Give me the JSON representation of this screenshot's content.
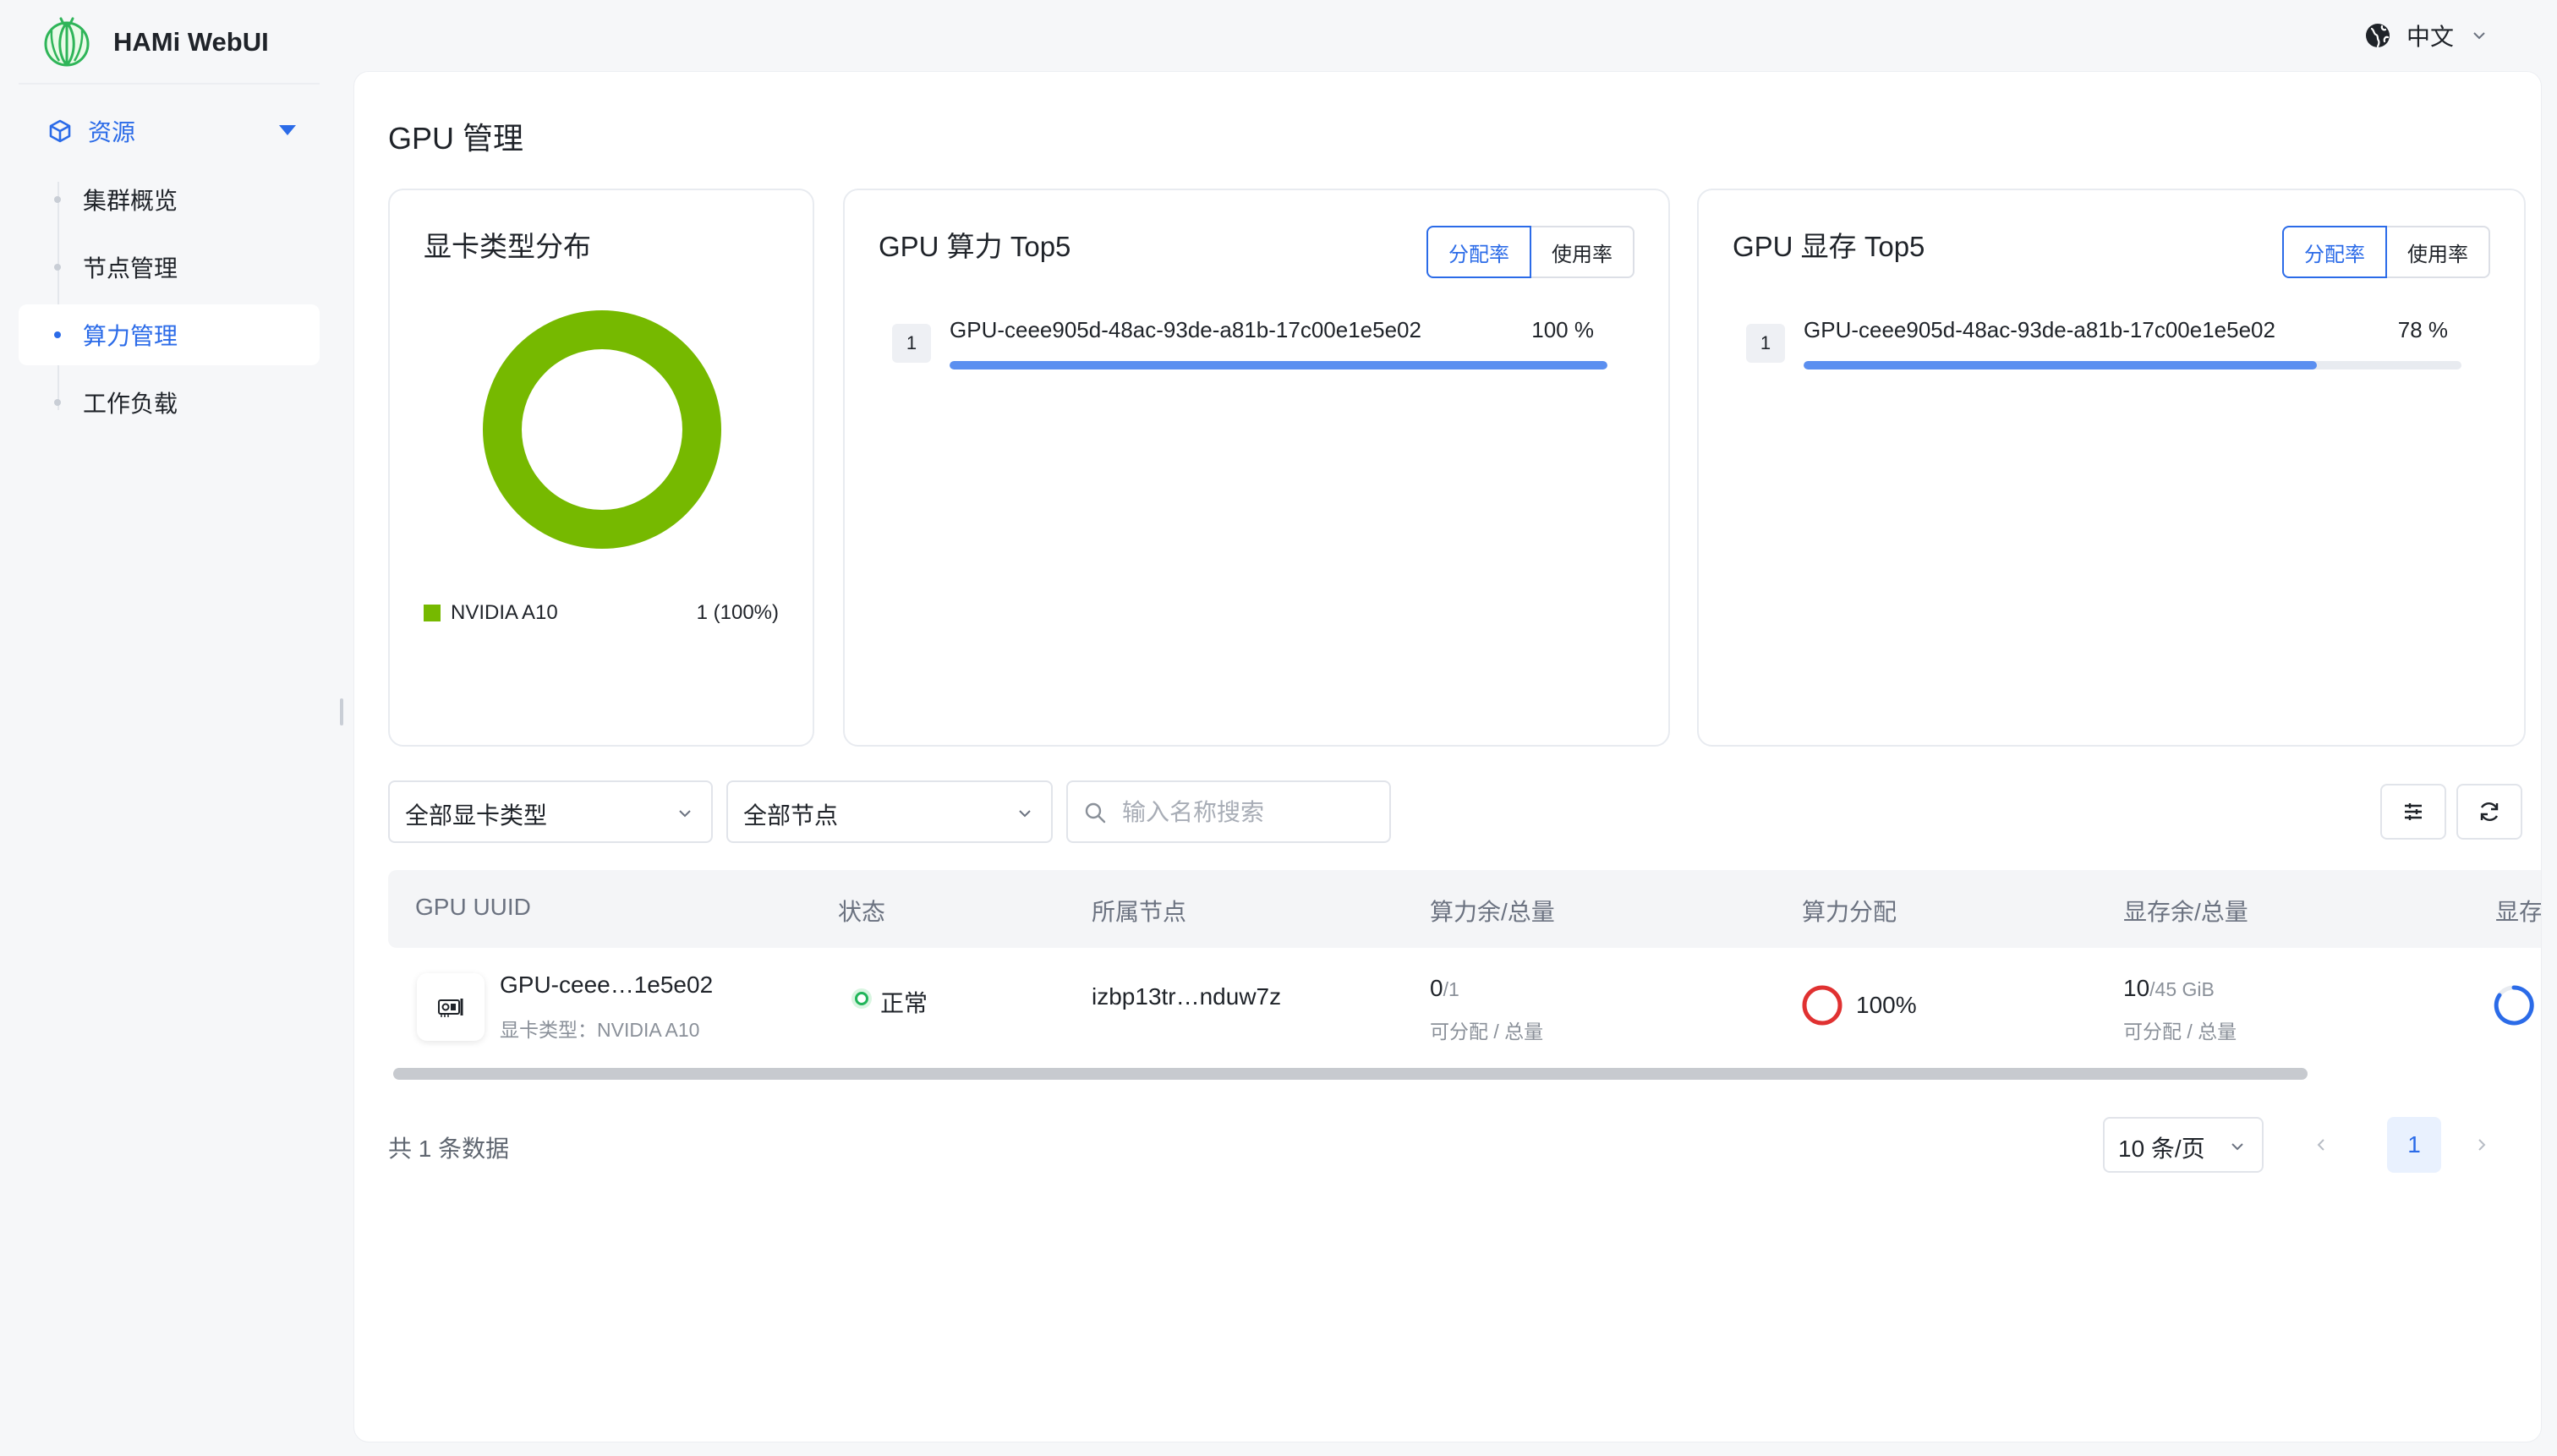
{
  "app": {
    "name": "HAMi WebUI"
  },
  "topbar": {
    "language": "中文"
  },
  "sidebar": {
    "group": {
      "label": "资源"
    },
    "items": [
      {
        "label": "集群概览"
      },
      {
        "label": "节点管理"
      },
      {
        "label": "算力管理",
        "active": true
      },
      {
        "label": "工作负载"
      }
    ]
  },
  "page": {
    "title": "GPU 管理"
  },
  "type_card": {
    "title": "显卡类型分布",
    "legend": [
      {
        "name": "NVIDIA A10",
        "value": "1 (100%)",
        "color": "#76b900"
      }
    ],
    "chart_data": {
      "type": "pie",
      "categories": [
        "NVIDIA A10"
      ],
      "values": [
        1
      ]
    }
  },
  "compute_card": {
    "title": "GPU 算力 Top5",
    "tabs": [
      "分配率",
      "使用率"
    ],
    "active_tab": "分配率",
    "items": [
      {
        "rank": "1",
        "name": "GPU-ceee905d-48ac-93de-a81b-17c00e1e5e02",
        "pct_text": "100 %",
        "pct": 100
      }
    ]
  },
  "memory_card": {
    "title": "GPU 显存 Top5",
    "tabs": [
      "分配率",
      "使用率"
    ],
    "active_tab": "分配率",
    "items": [
      {
        "rank": "1",
        "name": "GPU-ceee905d-48ac-93de-a81b-17c00e1e5e02",
        "pct_text": "78 %",
        "pct": 78
      }
    ]
  },
  "filters": {
    "gpu_type": "全部显卡类型",
    "node": "全部节点",
    "search_placeholder": "输入名称搜索"
  },
  "table": {
    "columns": [
      "GPU UUID",
      "状态",
      "所属节点",
      "算力余/总量",
      "算力分配",
      "显存余/总量",
      "显存"
    ],
    "rows": [
      {
        "uuid": "GPU-ceee…1e5e02",
        "type_label": "显卡类型：NVIDIA A10",
        "status": "正常",
        "node": "izbp13tr…nduw7z",
        "compute_free": "0",
        "compute_total": "/1",
        "compute_sub": "可分配 / 总量",
        "compute_alloc": "100%",
        "compute_alloc_value": 100,
        "memory_free": "10",
        "memory_total": "/45 GiB",
        "memory_sub": "可分配 / 总量"
      }
    ]
  },
  "footer": {
    "total": "共 1 条数据",
    "page_size": "10 条/页",
    "current_page": "1"
  },
  "colors": {
    "accent": "#2b6be8",
    "nvidia_green": "#76b900",
    "bar_blue": "#5b8ff0",
    "alloc_red": "#e03131"
  }
}
